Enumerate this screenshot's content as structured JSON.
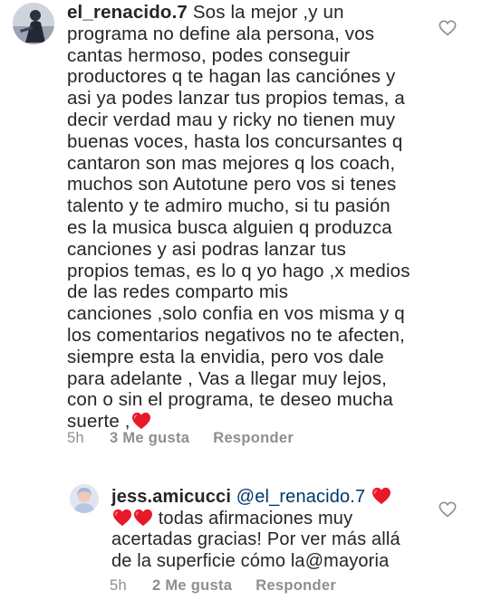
{
  "comments": [
    {
      "username": "el_renacido.7",
      "lines": [
        "Sos la mejor ,y un",
        "programa no define ala persona, vos",
        "cantas hermoso, podes conseguir",
        "productores q te hagan las canciónes y",
        "asi ya podes lanzar tus propios temas, a",
        "decir verdad mau y ricky no tienen muy",
        "buenas voces, hasta los concursantes q",
        "cantaron son mas mejores q los coach,",
        "muchos son Autotune pero vos si tenes",
        "talento y te admiro mucho, si tu pasión",
        "es la musica busca alguien q produzca",
        "canciones y asi podras lanzar tus",
        "propios temas, es lo q yo hago ,x medios",
        "de las redes comparto mis",
        "canciones ,solo confia en vos misma y q",
        "los comentarios negativos no te afecten,",
        "siempre esta la envidia, pero vos dale",
        "para adelante , Vas a llegar muy lejos,",
        "con o sin el programa, te deseo mucha",
        "suerte ,"
      ],
      "time": "5h",
      "likes": "3 Me gusta",
      "reply": "Responder"
    },
    {
      "username": "jess.amicucci",
      "mention": "@el_renacido.7",
      "line2": "todas afirmaciones muy",
      "line3": "acertadas gracias! Por ver más allá",
      "line4": "de la superficie cómo la@mayoria",
      "time": "5h",
      "likes": "2 Me gusta",
      "reply": "Responder"
    }
  ],
  "icons": {
    "like": "heart-outline-icon",
    "emoji": "red-heart-emoji",
    "heart_color": "#e8182b"
  }
}
